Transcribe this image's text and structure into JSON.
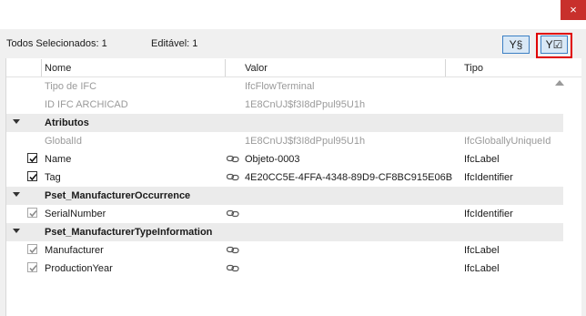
{
  "window": {
    "close_glyph": "×"
  },
  "toolbar": {
    "all_selected": "Todos Selecionados: 1",
    "editable": "Editável: 1",
    "filter_btn_1_label": "Y§",
    "filter_btn_2_label": "Y☑"
  },
  "columns": {
    "name": "Nome",
    "value": "Valor",
    "type": "Tipo"
  },
  "rows": [
    {
      "kind": "info",
      "name": "Tipo de IFC",
      "value": "IfcFlowTerminal",
      "type": ""
    },
    {
      "kind": "info",
      "name": "ID IFC ARCHICAD",
      "value": "1E8CnUJ$f3I8dPpul95U1h",
      "type": ""
    },
    {
      "kind": "group",
      "name": "Atributos"
    },
    {
      "kind": "info",
      "name": "GlobalId",
      "value": "1E8CnUJ$f3I8dPpul95U1h",
      "type": "IfcGloballyUniqueId"
    },
    {
      "kind": "prop",
      "checked": true,
      "dim": false,
      "name": "Name",
      "link": true,
      "value": "Objeto-0003",
      "type": "IfcLabel"
    },
    {
      "kind": "prop",
      "checked": true,
      "dim": false,
      "name": "Tag",
      "link": true,
      "value": "4E20CC5E-4FFA-4348-89D9-CF8BC915E06B",
      "type": "IfcIdentifier"
    },
    {
      "kind": "group",
      "name": "Pset_ManufacturerOccurrence"
    },
    {
      "kind": "prop",
      "checked": true,
      "dim": true,
      "name": "SerialNumber",
      "link": true,
      "value": "",
      "type": "IfcIdentifier"
    },
    {
      "kind": "group",
      "name": "Pset_ManufacturerTypeInformation"
    },
    {
      "kind": "prop",
      "checked": true,
      "dim": true,
      "name": "Manufacturer",
      "link": true,
      "value": "",
      "type": "IfcLabel"
    },
    {
      "kind": "prop",
      "checked": true,
      "dim": true,
      "name": "ProductionYear",
      "link": true,
      "value": "",
      "type": "IfcLabel"
    }
  ],
  "colors": {
    "accent": "#3b7fc4",
    "highlight": "#e00000",
    "close": "#c8302c"
  }
}
